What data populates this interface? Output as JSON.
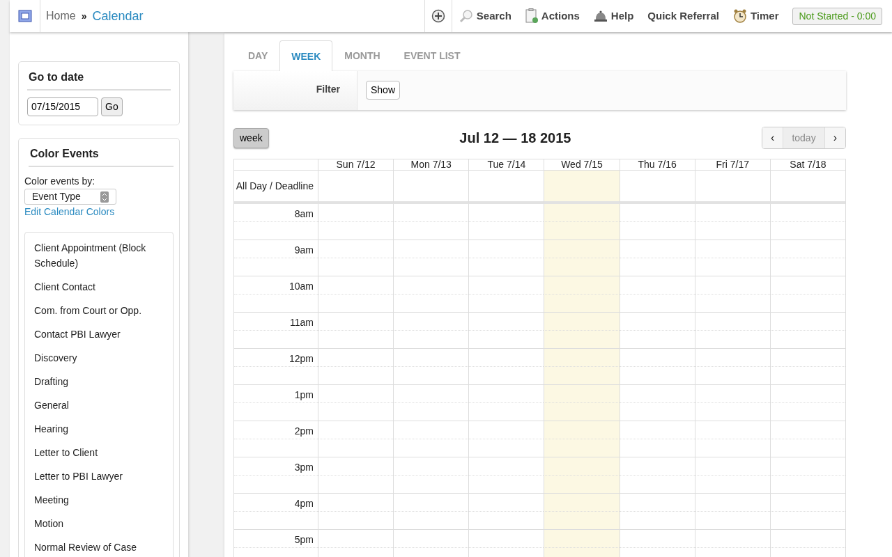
{
  "breadcrumb": {
    "home": "Home",
    "separator": "»",
    "current": "Calendar"
  },
  "toolbar": [
    {
      "kind": "search",
      "label": "Search"
    },
    {
      "kind": "actions",
      "label": "Actions"
    },
    {
      "kind": "help",
      "label": "Help"
    },
    {
      "kind": "plain",
      "label": "Quick Referral"
    },
    {
      "kind": "timer",
      "label": "Timer"
    }
  ],
  "timer_status": "Not Started - 0:00",
  "go_to_date": {
    "title": "Go to date",
    "value": "07/15/2015",
    "button": "Go"
  },
  "color_events": {
    "title_text": "Color Events",
    "by_label": "Color events by:",
    "by_value": "Event Type",
    "edit_link": "Edit Calendar Colors",
    "event_types": [
      "Client Appointment (Block Schedule)",
      "Client Contact",
      "Com. from Court or Opp.",
      "Contact PBI Lawyer",
      "Discovery",
      "Drafting",
      "General",
      "Hearing",
      "Letter to Client",
      "Letter to PBI Lawyer",
      "Meeting",
      "Motion",
      "Normal Review of Case"
    ]
  },
  "tabs": [
    {
      "label": "DAY",
      "selected": false
    },
    {
      "label": "WEEK",
      "selected": true
    },
    {
      "label": "MONTH",
      "selected": false
    },
    {
      "label": "EVENT LIST",
      "selected": false
    }
  ],
  "filter": {
    "label": "Filter",
    "button": "Show"
  },
  "calendar": {
    "view_button": "week",
    "range_title": "Jul 12 — 18 2015",
    "prev": "‹",
    "today": "today",
    "next": "›",
    "all_day_label": "All Day / Deadline",
    "days": [
      {
        "label": "Sun 7/12",
        "today": false
      },
      {
        "label": "Mon 7/13",
        "today": false
      },
      {
        "label": "Tue 7/14",
        "today": false
      },
      {
        "label": "Wed 7/15",
        "today": true
      },
      {
        "label": "Thu 7/16",
        "today": false
      },
      {
        "label": "Fri 7/17",
        "today": false
      },
      {
        "label": "Sat 7/18",
        "today": false
      }
    ],
    "hours": [
      "8am",
      "9am",
      "10am",
      "11am",
      "12pm",
      "1pm",
      "2pm",
      "3pm",
      "4pm",
      "5pm"
    ]
  }
}
